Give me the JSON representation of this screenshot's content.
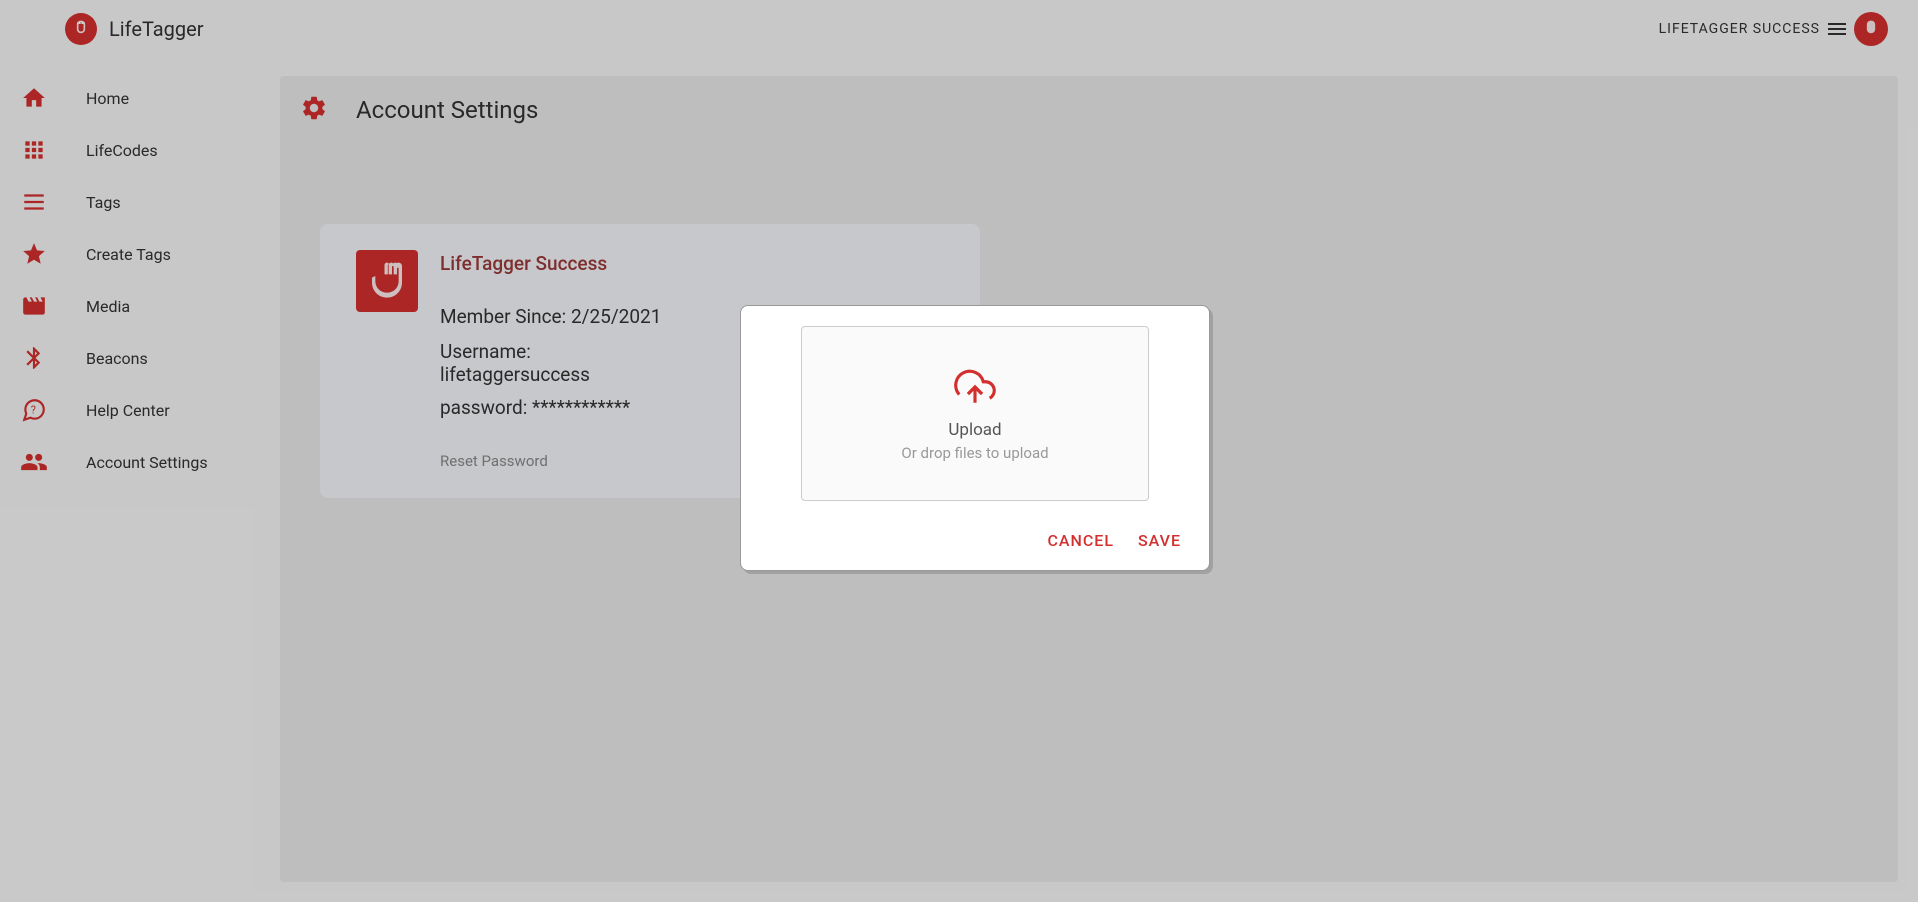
{
  "app": {
    "title": "LifeTagger"
  },
  "header": {
    "user_label": "LIFETAGGER SUCCESS"
  },
  "sidebar": {
    "items": [
      {
        "label": "Home"
      },
      {
        "label": "LifeCodes"
      },
      {
        "label": "Tags"
      },
      {
        "label": "Create Tags"
      },
      {
        "label": "Media"
      },
      {
        "label": "Beacons"
      },
      {
        "label": "Help Center"
      },
      {
        "label": "Account Settings"
      }
    ]
  },
  "page": {
    "title": "Account Settings"
  },
  "account": {
    "display_name": "LifeTagger Success",
    "member_since_label": "Member Since:",
    "member_since_value": "2/25/2021",
    "username_label": "Username:",
    "username_value": "lifetaggersuccess",
    "password_label": "password:",
    "password_value": "************",
    "reset_link": "Reset Password"
  },
  "modal": {
    "upload_title": "Upload",
    "upload_subtext": "Or drop files to upload",
    "cancel": "CANCEL",
    "save": "SAVE"
  }
}
